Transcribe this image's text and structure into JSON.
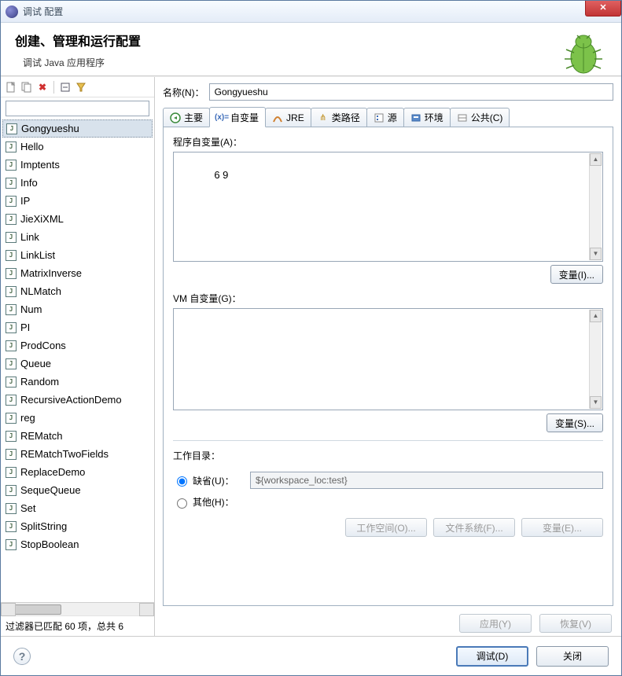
{
  "window": {
    "title": "调试 配置"
  },
  "header": {
    "title": "创建、管理和运行配置",
    "subtitle": "调试 Java 应用程序"
  },
  "left": {
    "filter_placeholder": "",
    "items": [
      "Gongyueshu",
      "Hello",
      "Imptents",
      "Info",
      "IP",
      "JieXiXML",
      "Link",
      "LinkList",
      "MatrixInverse",
      "NLMatch",
      "Num",
      "PI",
      "ProdCons",
      "Queue",
      "Random",
      "RecursiveActionDemo",
      "reg",
      "REMatch",
      "REMatchTwoFields",
      "ReplaceDemo",
      "SequeQueue",
      "Set",
      "SplitString",
      "StopBoolean"
    ],
    "selected_index": 0,
    "status": "过滤器已匹配 60 项，总共 6"
  },
  "right": {
    "name_label": "名称(N)：",
    "name_value": "Gongyueshu",
    "tabs": [
      {
        "label": "主要"
      },
      {
        "label": "自变量"
      },
      {
        "label": "JRE"
      },
      {
        "label": "类路径"
      },
      {
        "label": "源"
      },
      {
        "label": "环境"
      },
      {
        "label": "公共(C)"
      }
    ],
    "active_tab": 1,
    "arguments": {
      "program_label": "程序自变量(A)：",
      "program_value": "6 9",
      "program_var_btn": "变量(I)...",
      "vm_label": "VM 自变量(G)：",
      "vm_value": "",
      "vm_var_btn": "变量(S)..."
    },
    "workdir": {
      "title": "工作目录：",
      "default_label": "缺省(U)：",
      "default_value": "${workspace_loc:test}",
      "other_label": "其他(H)：",
      "btns": {
        "workspace": "工作空间(O)...",
        "filesystem": "文件系统(F)...",
        "variables": "变量(E)..."
      }
    },
    "apply": {
      "apply": "应用(Y)",
      "revert": "恢复(V)"
    }
  },
  "footer": {
    "debug": "调试(D)",
    "close": "关闭"
  }
}
